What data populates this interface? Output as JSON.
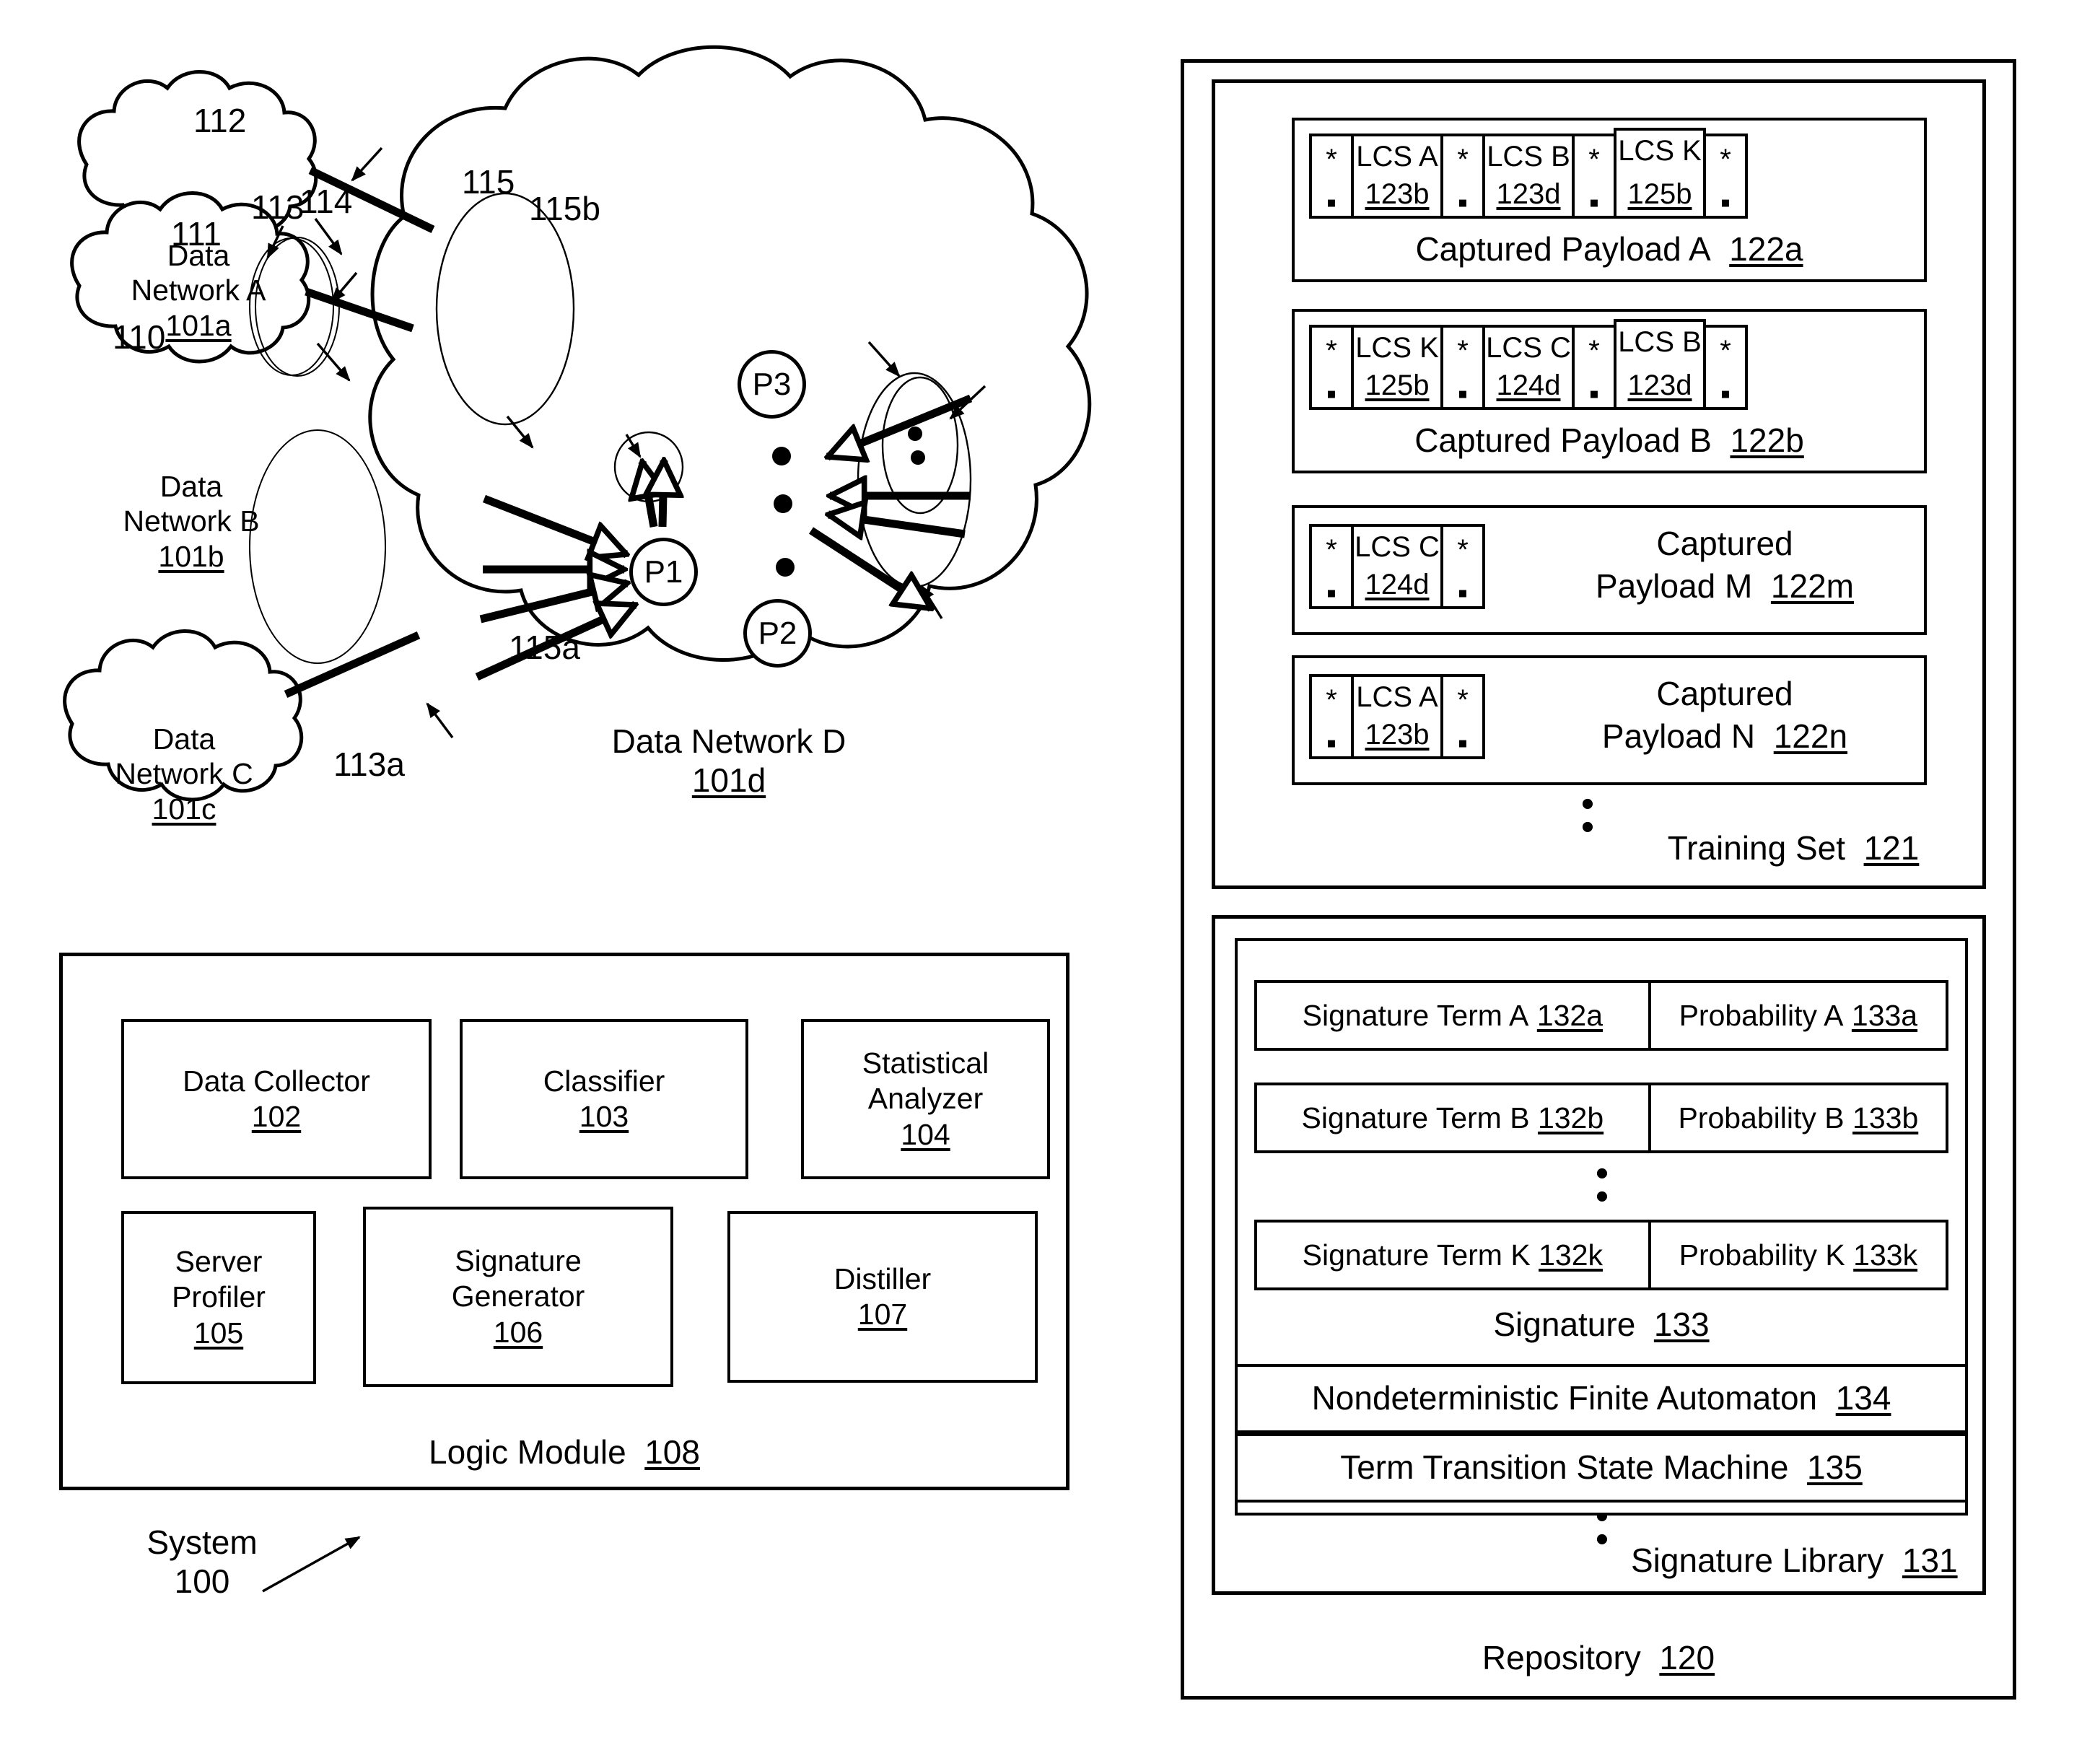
{
  "figure": {
    "system_label": "System",
    "system_ref": "100"
  },
  "networks": [
    {
      "name": "Data",
      "name2": "Network A",
      "ref": "101a"
    },
    {
      "name": "Data",
      "name2": "Network B",
      "ref": "101b"
    },
    {
      "name": "Data",
      "name2": "Network C",
      "ref": "101c"
    }
  ],
  "cloud": {
    "title": "Data Network D",
    "ref": "101d",
    "nodes": [
      {
        "label": "P1"
      },
      {
        "label": "P2"
      },
      {
        "label": "P3"
      }
    ],
    "callouts": [
      {
        "ref": "110"
      },
      {
        "ref": "111"
      },
      {
        "ref": "112"
      },
      {
        "ref": "113"
      },
      {
        "ref": "113a"
      },
      {
        "ref": "114"
      },
      {
        "ref": "115"
      },
      {
        "ref": "115a"
      },
      {
        "ref": "115b"
      }
    ]
  },
  "logic_module": {
    "title": "Logic Module",
    "ref": "108",
    "components": [
      {
        "name": "Data Collector",
        "ref": "102"
      },
      {
        "name": "Classifier",
        "ref": "103"
      },
      {
        "name": "Statistical\nAnalyzer",
        "line1": "Statistical",
        "line2": "Analyzer",
        "ref": "104"
      },
      {
        "name": "Server\nProfiler",
        "line1": "Server",
        "line2": "Profiler",
        "ref": "105"
      },
      {
        "name": "Signature\nGenerator",
        "line1": "Signature",
        "line2": "Generator",
        "ref": "106"
      },
      {
        "name": "Distiller",
        "ref": "107"
      }
    ]
  },
  "repository": {
    "title": "Repository",
    "ref": "120",
    "training_set": {
      "title": "Training Set",
      "ref": "121",
      "wildcard_glyph": "*",
      "wildcard_dot": "▪",
      "payloads": [
        {
          "title": "Captured Payload A",
          "title_line1": "Captured Payload A",
          "ref": "122a",
          "layout": "inline",
          "cells": [
            {
              "type": "wildcard"
            },
            {
              "type": "lcs",
              "name": "LCS A",
              "ref": "123b"
            },
            {
              "type": "wildcard"
            },
            {
              "type": "lcs",
              "name": "LCS B",
              "ref": "123d"
            },
            {
              "type": "wildcard"
            },
            {
              "type": "lcs",
              "name": "LCS K",
              "ref": "125b",
              "raised": true
            },
            {
              "type": "wildcard"
            }
          ]
        },
        {
          "title": "Captured Payload B",
          "title_line1": "Captured Payload B",
          "ref": "122b",
          "layout": "inline",
          "cells": [
            {
              "type": "wildcard"
            },
            {
              "type": "lcs",
              "name": "LCS K",
              "ref": "125b"
            },
            {
              "type": "wildcard"
            },
            {
              "type": "lcs",
              "name": "LCS C",
              "ref": "124d"
            },
            {
              "type": "wildcard"
            },
            {
              "type": "lcs",
              "name": "LCS B",
              "ref": "123d",
              "raised": true
            },
            {
              "type": "wildcard"
            }
          ]
        },
        {
          "title": "Captured\nPayload M",
          "title_line1": "Captured",
          "title_line2": "Payload M",
          "ref": "122m",
          "layout": "side",
          "cells": [
            {
              "type": "wildcard"
            },
            {
              "type": "lcs",
              "name": "LCS C",
              "ref": "124d"
            },
            {
              "type": "wildcard"
            }
          ]
        },
        {
          "title": "Captured\nPayload N",
          "title_line1": "Captured",
          "title_line2": "Payload N",
          "ref": "122n",
          "layout": "side",
          "cells": [
            {
              "type": "wildcard"
            },
            {
              "type": "lcs",
              "name": "LCS A",
              "ref": "123b"
            },
            {
              "type": "wildcard"
            }
          ]
        }
      ]
    },
    "signature_library": {
      "title": "Signature Library",
      "ref": "131",
      "signature": {
        "title": "Signature",
        "ref": "133",
        "rows": [
          {
            "term": "Signature Term A",
            "term_ref": "132a",
            "prob": "Probability A",
            "prob_ref": "133a"
          },
          {
            "term": "Signature Term B",
            "term_ref": "132b",
            "prob": "Probability B",
            "prob_ref": "133b"
          },
          {
            "term": "Signature Term K",
            "term_ref": "132k",
            "prob": "Probability K",
            "prob_ref": "133k"
          }
        ]
      },
      "automaton": {
        "name": "Nondeterministic Finite Automaton",
        "ref": "134"
      },
      "state_machine": {
        "name": "Term Transition State Machine",
        "ref": "135"
      }
    }
  }
}
